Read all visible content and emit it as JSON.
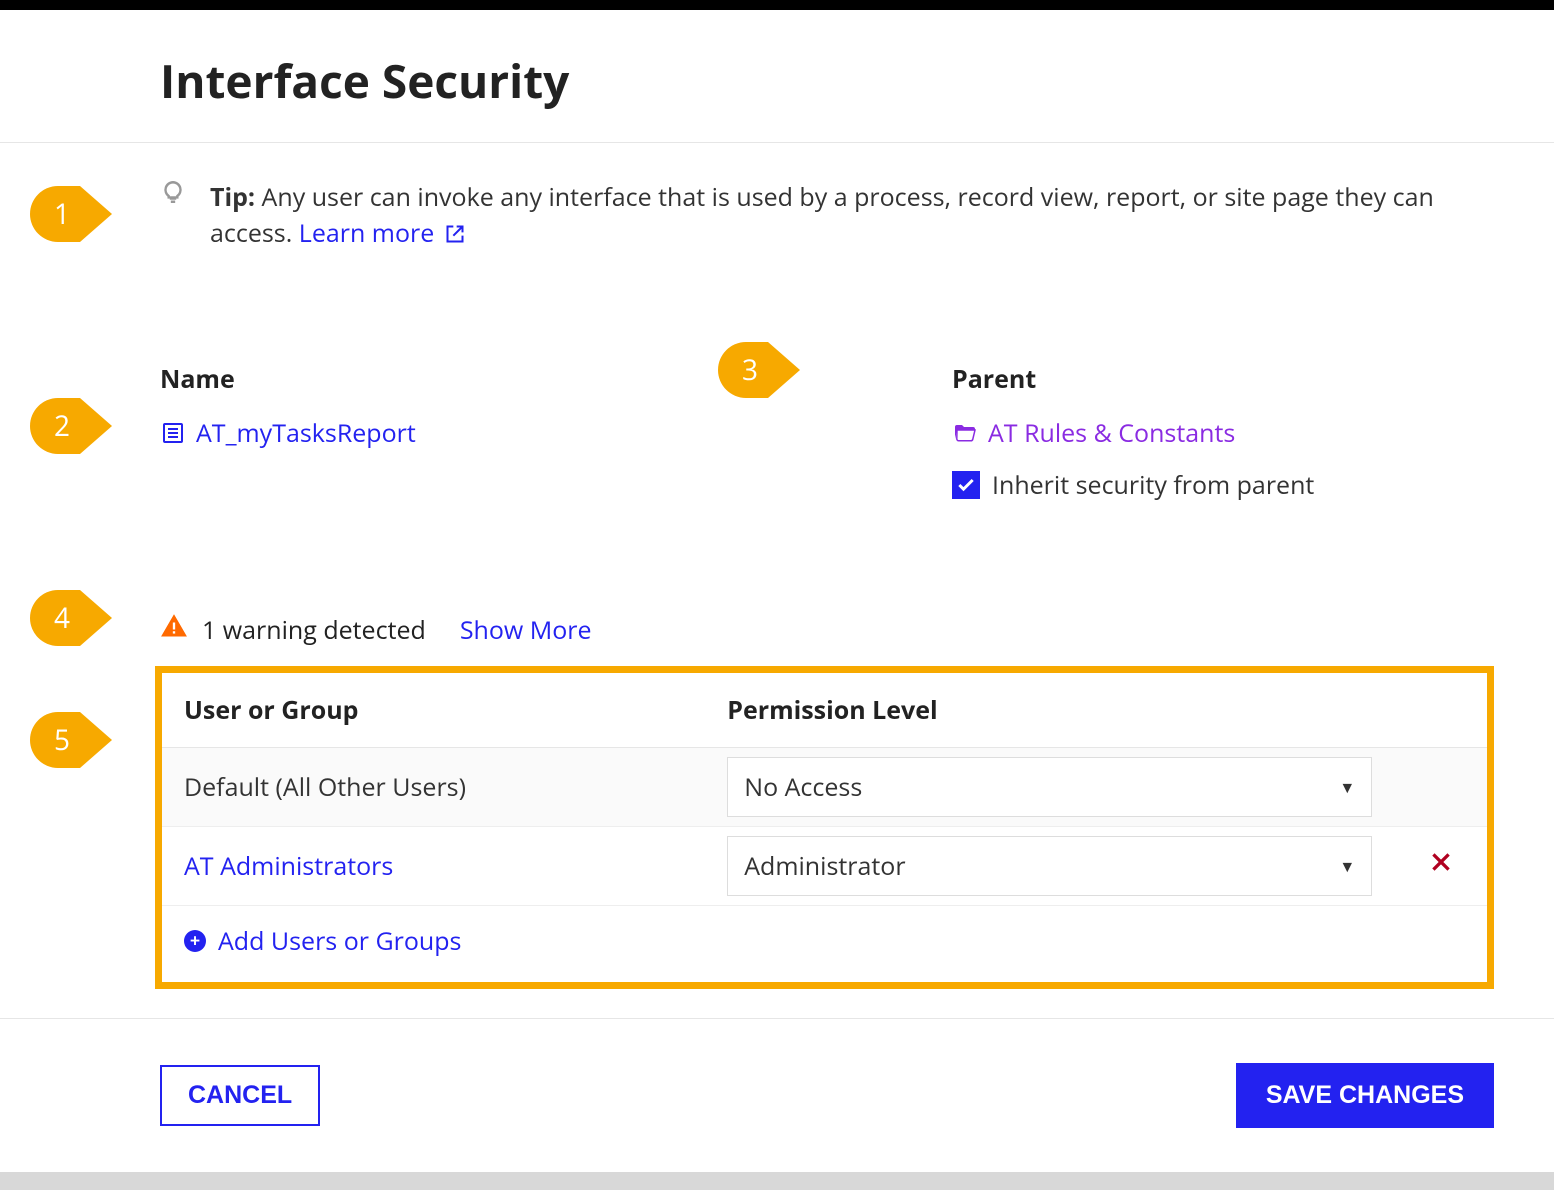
{
  "page": {
    "title": "Interface Security"
  },
  "callouts": [
    "1",
    "2",
    "3",
    "4",
    "5"
  ],
  "tip": {
    "label": "Tip:",
    "text": " Any user can invoke any interface that is used by a process, record view, report, or site page they can access. ",
    "link_text": "Learn more"
  },
  "name_field": {
    "label": "Name",
    "value": "AT_myTasksReport"
  },
  "parent_field": {
    "label": "Parent",
    "value": "AT Rules & Constants",
    "inherit_label": "Inherit security from parent",
    "inherit_checked": true
  },
  "warning": {
    "text": "1 warning detected",
    "show_more": "Show More"
  },
  "permissions_table": {
    "headers": {
      "user_or_group": "User or Group",
      "permission_level": "Permission Level"
    },
    "rows": [
      {
        "name": "Default (All Other Users)",
        "is_link": false,
        "permission": "No Access",
        "removable": false
      },
      {
        "name": "AT Administrators",
        "is_link": true,
        "permission": "Administrator",
        "removable": true
      }
    ],
    "add_label": "Add Users or Groups"
  },
  "footer": {
    "cancel": "CANCEL",
    "save": "SAVE CHANGES"
  }
}
